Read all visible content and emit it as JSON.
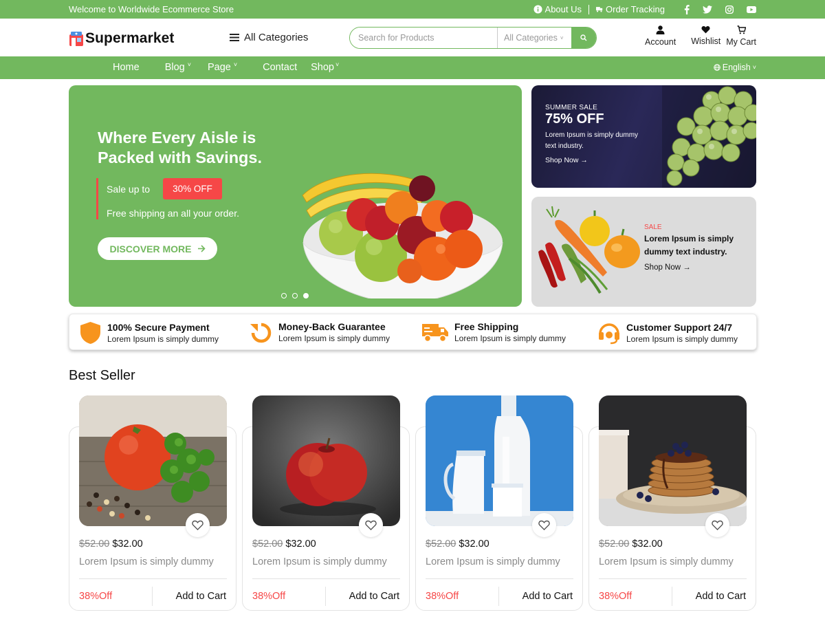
{
  "topbar": {
    "welcome": "Welcome to Worldwide Ecommerce Store",
    "about": "About Us",
    "tracking": "Order Tracking",
    "social": [
      "facebook-icon",
      "twitter-icon",
      "instagram-icon",
      "youtube-icon"
    ]
  },
  "header": {
    "logo": "Supermarket",
    "all_categories": "All Categories",
    "search": {
      "placeholder": "Search for Products",
      "category": "All Categories"
    },
    "account": "Account",
    "wishlist": "Wishlist",
    "cart": "My Cart"
  },
  "nav": {
    "items": [
      {
        "label": "Home",
        "dropdown": false
      },
      {
        "label": "Blog",
        "dropdown": true
      },
      {
        "label": "Page",
        "dropdown": true
      },
      {
        "label": "Contact",
        "dropdown": false
      },
      {
        "label": "Shop",
        "dropdown": true
      }
    ],
    "language": "English"
  },
  "hero": {
    "title": "Where Every Aisle is Packed with Savings.",
    "sale_text": "Sale up to",
    "badge": "30% OFF",
    "shipping": "Free shipping an all your order.",
    "cta": "DISCOVER MORE",
    "slides": 3,
    "active_slide": 3
  },
  "promo_top": {
    "tag": "SUMMER SALE",
    "headline": "75% OFF",
    "desc": "Lorem Ipsum is simply dummy text industry.",
    "link": "Shop Now"
  },
  "promo_bottom": {
    "tag": "SALE",
    "desc": "Lorem Ipsum is simply dummy text industry.",
    "link": "Shop Now"
  },
  "features": [
    {
      "title": "100% Secure Payment",
      "sub": "Lorem Ipsum is simply dummy",
      "icon": "shield-icon"
    },
    {
      "title": "Money-Back Guarantee",
      "sub": "Lorem Ipsum is simply dummy",
      "icon": "refresh-icon"
    },
    {
      "title": "Free Shipping",
      "sub": "Lorem Ipsum is simply dummy",
      "icon": "truck-icon"
    },
    {
      "title": "Customer Support 24/7",
      "sub": "Lorem Ipsum is simply dummy",
      "icon": "headset-icon"
    }
  ],
  "best_seller": {
    "title": "Best Seller",
    "products": [
      {
        "old_price": "$52.00",
        "price": "$32.00",
        "name": "Lorem Ipsum is simply dummy",
        "discount": "38%Off",
        "cta": "Add to Cart",
        "image": "tomato-parsley"
      },
      {
        "old_price": "$52.00",
        "price": "$32.00",
        "name": "Lorem Ipsum is simply dummy",
        "discount": "38%Off",
        "cta": "Add to Cart",
        "image": "red-apple"
      },
      {
        "old_price": "$52.00",
        "price": "$32.00",
        "name": "Lorem Ipsum is simply dummy",
        "discount": "38%Off",
        "cta": "Add to Cart",
        "image": "milk-bottle"
      },
      {
        "old_price": "$52.00",
        "price": "$32.00",
        "name": "Lorem Ipsum is simply dummy",
        "discount": "38%Off",
        "cta": "Add to Cart",
        "image": "pancakes"
      }
    ]
  },
  "colors": {
    "brand_green": "#72b85e",
    "sale_red": "#f64747",
    "feature_orange": "#f7941d",
    "promo_dark": "#1f1e3d"
  }
}
